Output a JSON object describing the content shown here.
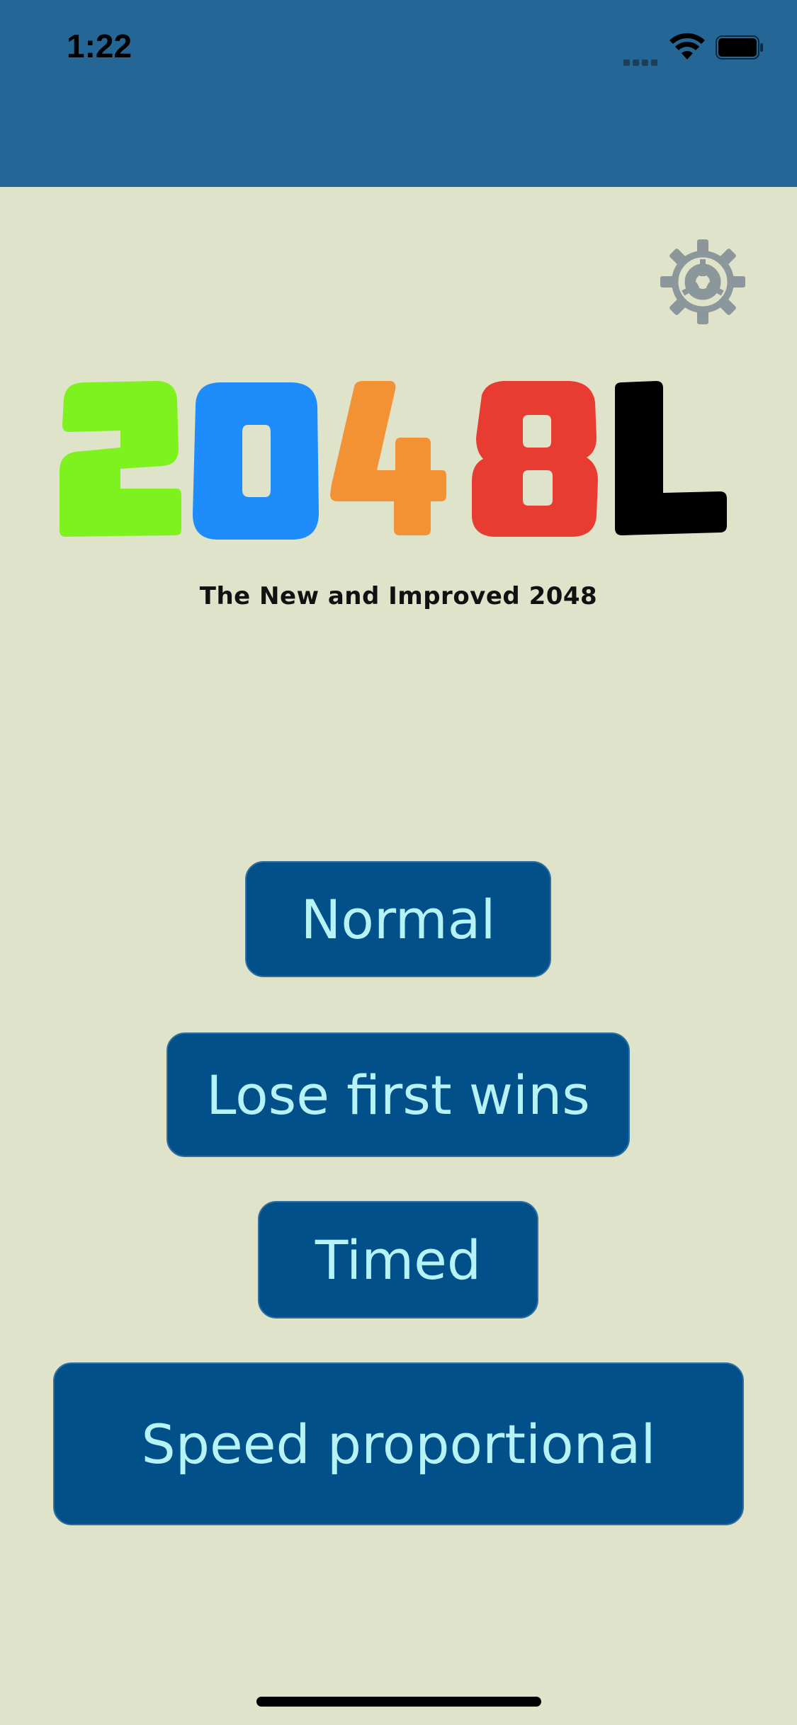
{
  "status_bar": {
    "time": "1:22"
  },
  "settings": {
    "icon": "gear-icon"
  },
  "logo": {
    "letters": [
      "2",
      "0",
      "4",
      "8",
      "L"
    ],
    "colors": [
      "#7ef21f",
      "#1f8cfb",
      "#f39235",
      "#e83b31",
      "#000000"
    ]
  },
  "subtitle": "The New and Improved 2048",
  "modes": {
    "normal": "Normal",
    "lose_first_wins": "Lose first wins",
    "timed": "Timed",
    "speed_proportional": "Speed proportional"
  },
  "colors": {
    "header": "#246695",
    "background": "#dee3c9",
    "button": "#02508a",
    "button_text": "#b6f3f7",
    "gear": "#8b979b"
  }
}
